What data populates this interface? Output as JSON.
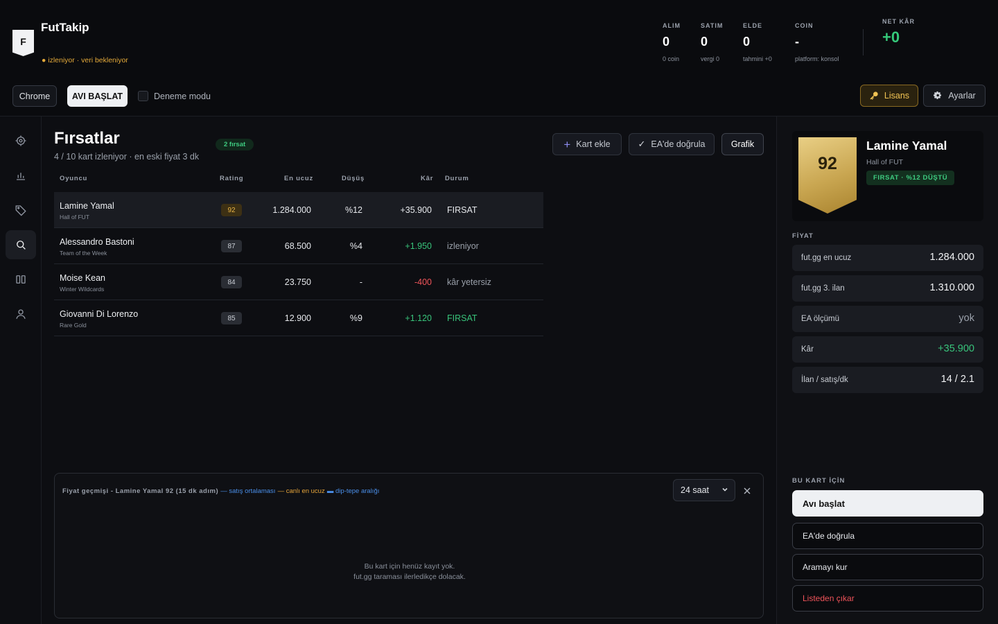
{
  "app": {
    "logo_letter": "F",
    "title": "FutTakip",
    "status": "● izleniyor · veri bekleniyor"
  },
  "stats": {
    "alim": {
      "label": "ALIM",
      "value": "0",
      "sub": "0 coin"
    },
    "satim": {
      "label": "SATIM",
      "value": "0",
      "sub": "vergi 0"
    },
    "elde": {
      "label": "ELDE",
      "value": "0",
      "sub": "tahmini +0"
    },
    "coin": {
      "label": "COIN",
      "value": "-",
      "sub": "platform: konsol"
    },
    "net": {
      "label": "NET KÂR",
      "value": "+0"
    }
  },
  "toolbar": {
    "chrome_label": "Chrome",
    "avi_label": "AVI BAŞLAT",
    "demo_label": "Deneme modu",
    "lisans_label": "Lisans",
    "ayarlar_label": "Ayarlar"
  },
  "sidebar": {
    "items": [
      {
        "icon": "target-icon",
        "active": false
      },
      {
        "icon": "bar-chart-icon",
        "active": false
      },
      {
        "icon": "tag-icon",
        "active": false
      },
      {
        "icon": "search-icon",
        "active": true
      },
      {
        "icon": "columns-icon",
        "active": false
      },
      {
        "icon": "user-icon",
        "active": false
      }
    ]
  },
  "main": {
    "title": "Fırsatlar",
    "badge": "2 fırsat",
    "subtitle": "4 / 10 kart izleniyor  ·  en eski fiyat 3 dk",
    "actions": {
      "kart_ekle": "Kart ekle",
      "ea_dogrula": "EA'de doğrula",
      "grafik": "Grafik"
    },
    "table": {
      "headers": {
        "oyuncu": "Oyuncu",
        "rating": "Rating",
        "en_ucuz": "En ucuz",
        "dusus": "Düşüş",
        "kar": "Kâr",
        "durum": "Durum"
      },
      "rows": [
        {
          "name": "Lamine Yamal",
          "version": "Hall of FUT",
          "rating": "92",
          "price": "1.284.000",
          "drop": "%12",
          "profit": "+35.900",
          "status": "FIRSAT"
        },
        {
          "name": "Alessandro Bastoni",
          "version": "Team of the Week",
          "rating": "87",
          "price": "68.500",
          "drop": "%4",
          "profit": "+1.950",
          "status": "izleniyor"
        },
        {
          "name": "Moise Kean",
          "version": "Winter Wildcards",
          "rating": "84",
          "price": "23.750",
          "drop": "-",
          "profit": "-400",
          "status": "kâr yetersiz"
        },
        {
          "name": "Giovanni Di Lorenzo",
          "version": "Rare Gold",
          "rating": "85",
          "price": "12.900",
          "drop": "%9",
          "profit": "+1.120",
          "status": "FIRSAT"
        }
      ]
    }
  },
  "chart_panel": {
    "title": "Fiyat geçmişi - Lamine Yamal 92   (15 dk adım)",
    "legend_sales": "— satış ortalaması",
    "legend_live": "— canlı en ucuz",
    "legend_range": "▬ dip-tepe aralığı",
    "range_value": "24 saat",
    "empty_line1": "Bu kart için henüz kayıt yok.",
    "empty_line2": "fut.gg taraması ilerledikçe dolacak."
  },
  "detail": {
    "rating": "92",
    "name": "Lamine Yamal",
    "version": "Hall of FUT",
    "badge": "FIRSAT · %12 DÜŞTÜ",
    "price_section": "FİYAT",
    "rows": [
      {
        "label": "fut.gg en ucuz",
        "value": "1.284.000"
      },
      {
        "label": "fut.gg 3. ilan",
        "value": "1.310.000"
      },
      {
        "label": "EA ölçümü",
        "value": "yok"
      },
      {
        "label": "Kâr",
        "value": "+35.900"
      },
      {
        "label": "İlan / satış/dk",
        "value": "14 / 2.1"
      }
    ],
    "action_section": "BU KART İÇİN",
    "actions": {
      "avi_baslat": "Avı başlat",
      "ea_dogrula": "EA'de doğrula",
      "aramayi_kur": "Aramayı kur",
      "listeden_cikar": "Listeden çıkar"
    }
  },
  "colors": {
    "accent_green": "#38c47b",
    "accent_gold": "#e9b446",
    "danger_red": "#f0545a",
    "background": "#0d0e12"
  }
}
